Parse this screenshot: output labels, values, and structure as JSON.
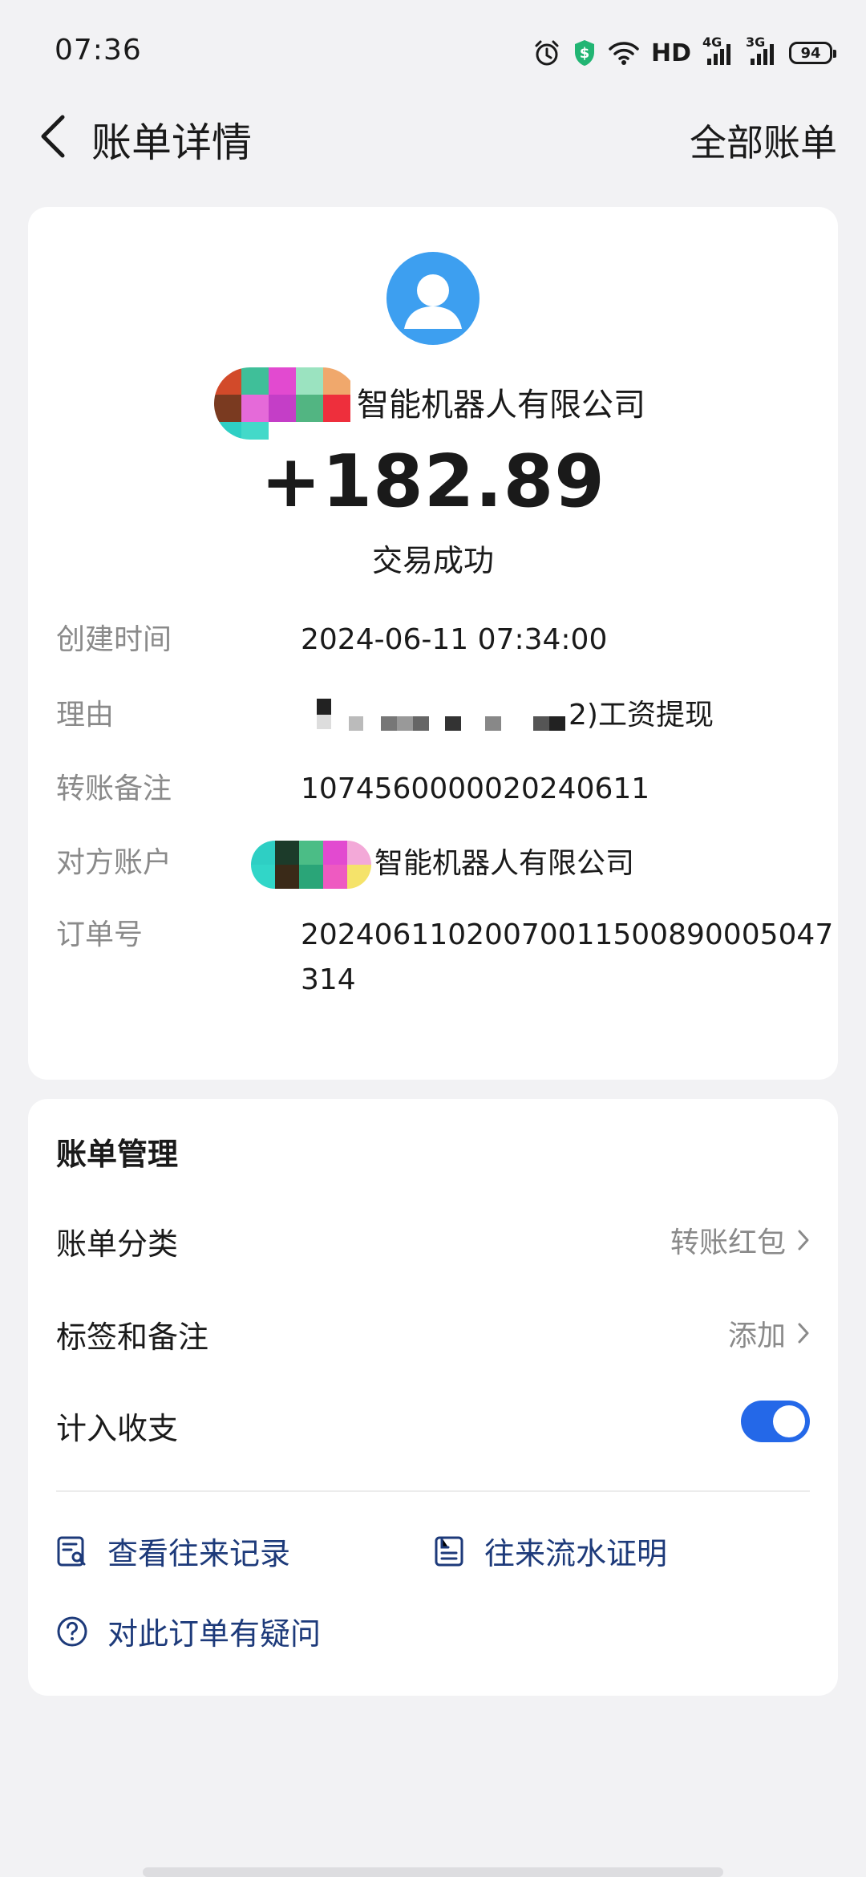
{
  "status_bar": {
    "time": "07:36",
    "network_label": "HD",
    "net_4g": "4G",
    "net_3g": "3G",
    "battery": "94",
    "icons": [
      "alarm-icon",
      "shield-icon",
      "wifi-icon",
      "signal-4g-icon",
      "signal-3g-icon",
      "battery-icon"
    ]
  },
  "header": {
    "title": "账单详情",
    "right_link": "全部账单",
    "back_icon": "chevron-left-icon"
  },
  "transaction": {
    "payee_visible": "智能机器人有限公司",
    "amount": "+182.89",
    "status": "交易成功",
    "avatar_icon": "user-avatar-icon"
  },
  "details": {
    "rows": [
      {
        "label": "创建时间",
        "value": "2024-06-11 07:34:00"
      },
      {
        "label": "理由",
        "value": "2)工资提现"
      },
      {
        "label": "转账备注",
        "value": "1074560000020240611"
      },
      {
        "label": "对方账户",
        "value": "智能机器人有限公司"
      },
      {
        "label": "订单号",
        "value": "20240611020070011500890005047314"
      }
    ]
  },
  "management": {
    "title": "账单管理",
    "category": {
      "label": "账单分类",
      "value": "转账红包"
    },
    "tags": {
      "label": "标签和备注",
      "value": "添加"
    },
    "count_in": {
      "label": "计入收支",
      "enabled": true
    },
    "actions": [
      {
        "label": "查看往来记录",
        "icon": "records-search-icon"
      },
      {
        "label": "往来流水证明",
        "icon": "document-icon"
      },
      {
        "label": "对此订单有疑问",
        "icon": "question-circle-icon"
      }
    ]
  },
  "colors": {
    "accent": "#2468e8",
    "link": "#1d3a7a",
    "avatar": "#3d9ff0",
    "label_gray": "#8a8a8a",
    "background": "#f2f2f4"
  }
}
